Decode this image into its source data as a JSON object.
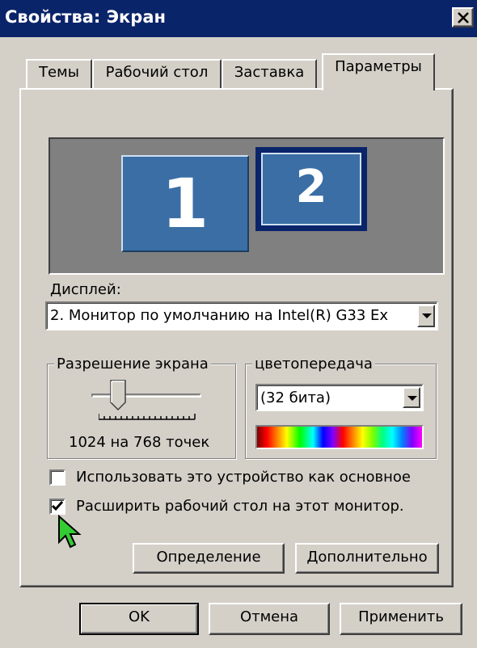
{
  "window": {
    "title": "Свойства: Экран",
    "close_label": "close"
  },
  "tabs": [
    {
      "label": "Темы",
      "active": false
    },
    {
      "label": "Рабочий стол",
      "active": false
    },
    {
      "label": "Заставка",
      "active": false
    },
    {
      "label": "Параметры",
      "active": true
    }
  ],
  "preview": {
    "monitor_1": "1",
    "monitor_2": "2",
    "selected_monitor": "2"
  },
  "display": {
    "label": "Дисплей:",
    "value": "2. Монитор по умолчанию на Intel(R) G33   Ex"
  },
  "resolution": {
    "group_title": "Разрешение экрана",
    "text": "1024 на 768 точек",
    "slider_level": 0.2
  },
  "color": {
    "group_title": "цветопередача",
    "value": "(32 бита)"
  },
  "options": {
    "primary_label": "Использовать это устройство как основное",
    "primary_checked": false,
    "extend_label": "Расширить рабочий стол на этот монитор.",
    "extend_checked": true
  },
  "panel_buttons": {
    "identify": "Определение",
    "advanced": "Дополнительно"
  },
  "dialog_buttons": {
    "ok": "OK",
    "cancel": "Отмена",
    "apply": "Применить"
  },
  "icons": {
    "close": "close-icon",
    "dropdown": "chevron-down-icon",
    "check": "checkmark-icon",
    "cursor": "mouse-pointer-icon"
  },
  "colors": {
    "title_bar": "#0a246a",
    "face": "#d4d0c8",
    "monitor": "#3a6ea5",
    "cursor": "#33cc33"
  }
}
